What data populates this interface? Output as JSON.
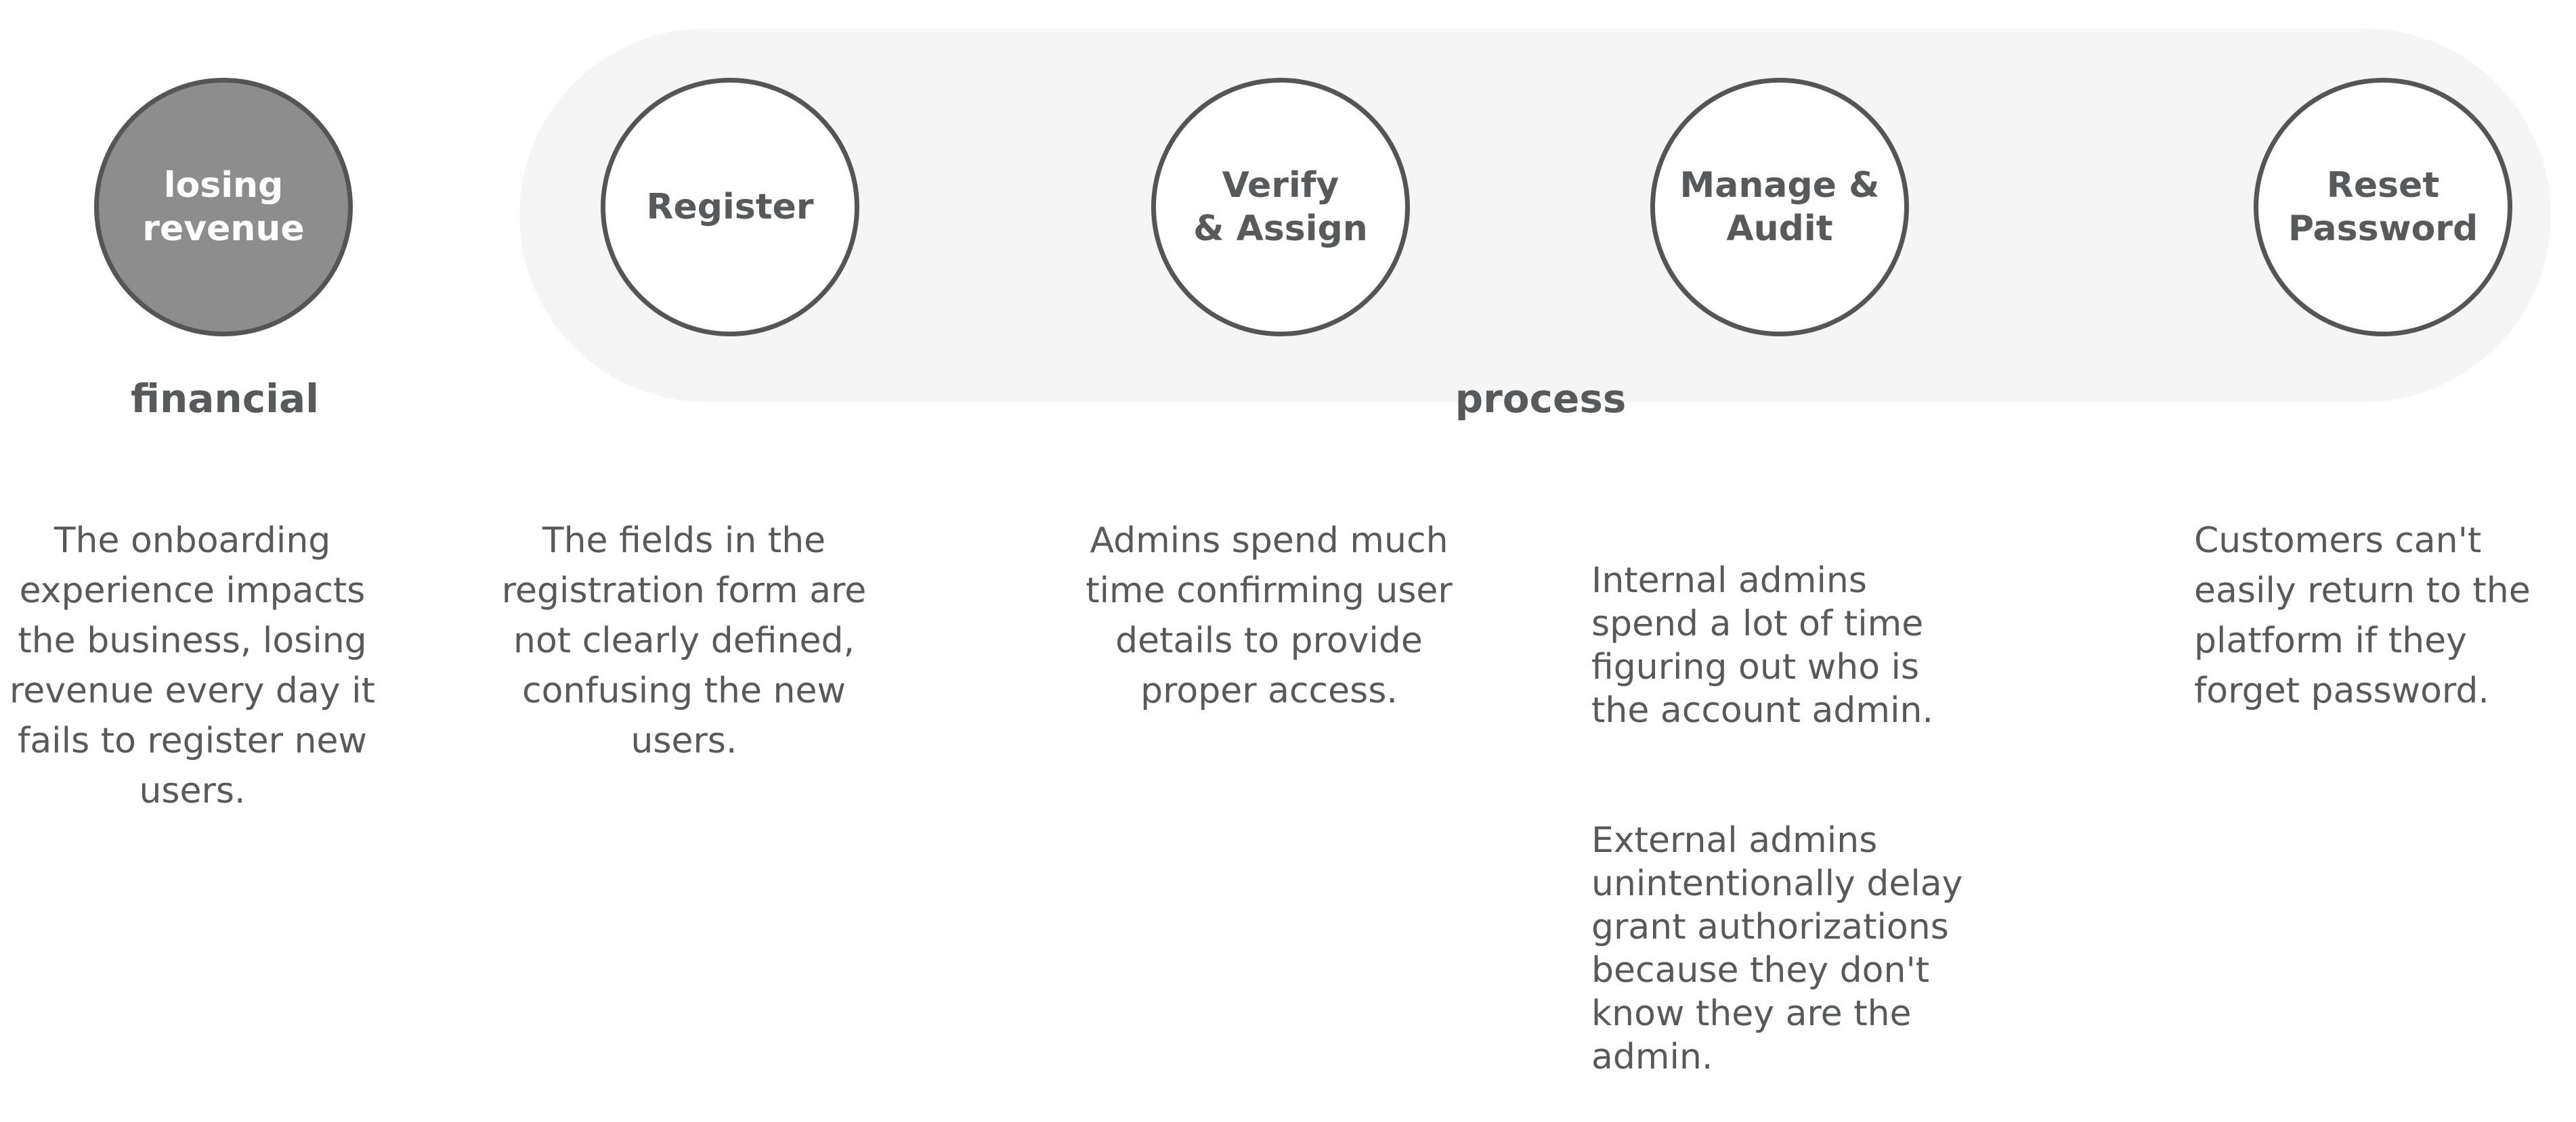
{
  "groups": {
    "financial": "financial",
    "process": "process"
  },
  "circles": {
    "losing_revenue": "losing\nrevenue",
    "register": "Register",
    "verify_assign": "Verify\n& Assign",
    "manage_audit": "Manage &\nAudit",
    "reset_password": "Reset\nPassword"
  },
  "descriptions": {
    "losing_revenue": "The onboarding\nexperience impacts\nthe business, losing\nrevenue every day it\nfails to register new\nusers.",
    "register": "The fields in the\nregistration form are\nnot clearly defined,\nconfusing the new\nusers.",
    "verify_assign": "Admins spend much\ntime confirming user\ndetails to provide\nproper access.",
    "manage_audit_internal": "Internal admins\nspend a lot of time\nfiguring out who is\nthe account admin.",
    "manage_audit_external": "External admins\nunintentionally delay\ngrant authorizations\nbecause they don't\nknow they are the\nadmin.",
    "reset_password": "Customers can't\neasily return to the\nplatform if they\nforget password."
  },
  "colors": {
    "text": "#58595b",
    "circle_border": "#555557",
    "circle_dark_fill": "#8d8d8d",
    "pill_background": "#f5f5f5"
  }
}
